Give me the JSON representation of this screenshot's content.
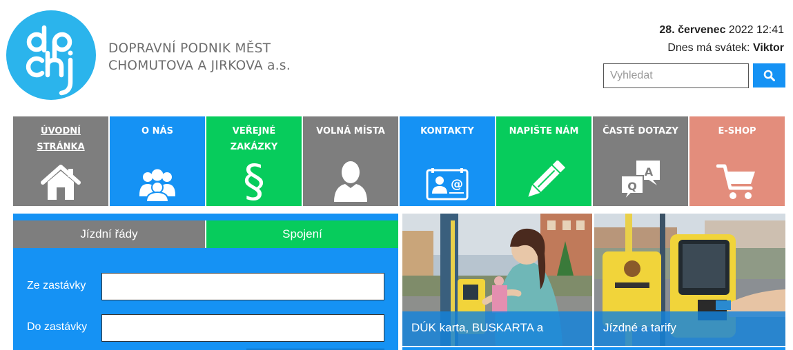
{
  "header": {
    "logo_text": "dpchj",
    "company_line1": "DOPRAVNÍ PODNIK MĚST",
    "company_line2": "CHOMUTOVA A JIRKOVA a.s.",
    "date_bold": "28. červenec",
    "date_rest": "2022 12:41",
    "nameday_prefix": "Dnes má svátek:",
    "nameday_name": "Viktor",
    "search_placeholder": "Vyhledat",
    "search_icon": "search-icon"
  },
  "nav": {
    "tiles": [
      {
        "label": "ÚVODNÍ STRÁNKA",
        "icon": "home-icon",
        "color": "#7e7e7e"
      },
      {
        "label": "O NÁS",
        "icon": "people-group-icon",
        "color": "#1592f4"
      },
      {
        "label": "VEŘEJNÉ ZAKÁZKY",
        "icon": "section-sign-icon",
        "color": "#07cc5c"
      },
      {
        "label": "VOLNÁ MÍSTA",
        "icon": "person-silhouette-icon",
        "color": "#7e7e7e"
      },
      {
        "label": "KONTAKTY",
        "icon": "contact-card-icon",
        "color": "#1592f4"
      },
      {
        "label": "NAPIŠTE NÁM",
        "icon": "pencil-icon",
        "color": "#07cc5c"
      },
      {
        "label": "ČASTÉ DOTAZY",
        "icon": "qa-bubbles-icon",
        "color": "#7e7e7e"
      },
      {
        "label": "E-SHOP",
        "icon": "shopping-cart-icon",
        "color": "#e38d7c"
      }
    ]
  },
  "timetable": {
    "tab_timetables": "Jízdní řády",
    "tab_connections": "Spojení",
    "from_label": "Ze zastávky",
    "from_value": "",
    "to_label": "Do zastávky",
    "to_value": ""
  },
  "promos": [
    {
      "caption": "DÚK karta, BUSKARTA a odbavení"
    },
    {
      "caption": "Jízdné a tarify"
    }
  ],
  "colors": {
    "brand_blue": "#1592f4",
    "brand_green": "#07cc5c",
    "brand_gray": "#7e7e7e",
    "eshop_salmon": "#e38d7c",
    "logo_blue": "#2bb4ec"
  }
}
